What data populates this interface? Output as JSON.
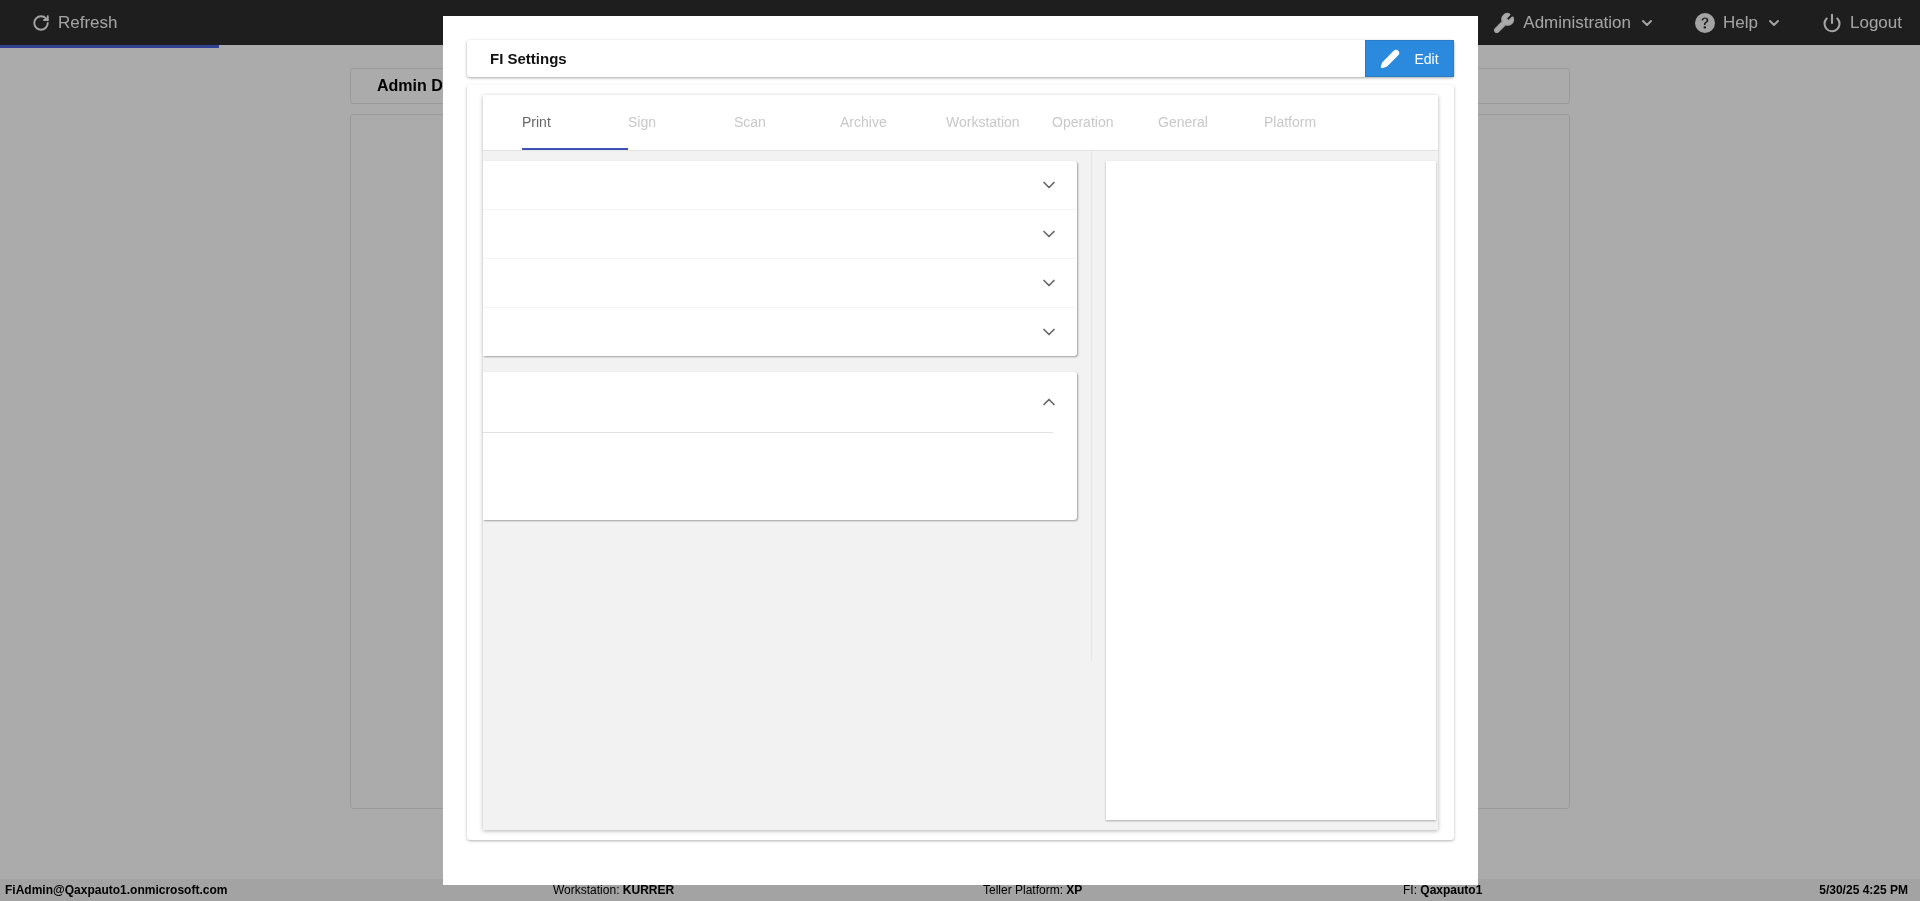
{
  "top_bar": {
    "refresh": "Refresh",
    "menus": [
      {
        "kind": "admin",
        "label": "Administration"
      },
      {
        "kind": "help",
        "label": "Help"
      }
    ],
    "logout": "Logout"
  },
  "loading_bar": {
    "level": 0.114
  },
  "page": {
    "card_title": "Admin D"
  },
  "status_bar": [
    "FiAdmin@Qaxpauto1.onmicrosoft.com",
    "Workstation: **KURRER**",
    "Teller Platform: **XP**",
    "FI: **Qaxpauto1**",
    "5/30/25 4:25 PM"
  ],
  "dialog": {
    "title": "FI Settings",
    "edit_button": "Edit",
    "tabs": [
      {
        "label": "Print",
        "selected": true
      },
      {
        "label": "Sign",
        "selected": false
      },
      {
        "label": "Scan",
        "selected": false
      },
      {
        "label": "Archive",
        "selected": false
      },
      {
        "label": "Workstation",
        "selected": false
      },
      {
        "label": "Operation",
        "selected": false
      },
      {
        "label": "General",
        "selected": false
      },
      {
        "label": "Platform",
        "selected": false
      }
    ],
    "accordion_groups": [
      {
        "sections": [
          {
            "expanded": false
          },
          {
            "expanded": false
          },
          {
            "expanded": false
          },
          {
            "expanded": false
          }
        ]
      },
      {
        "sections": [
          {
            "expanded": true
          }
        ]
      }
    ]
  }
}
